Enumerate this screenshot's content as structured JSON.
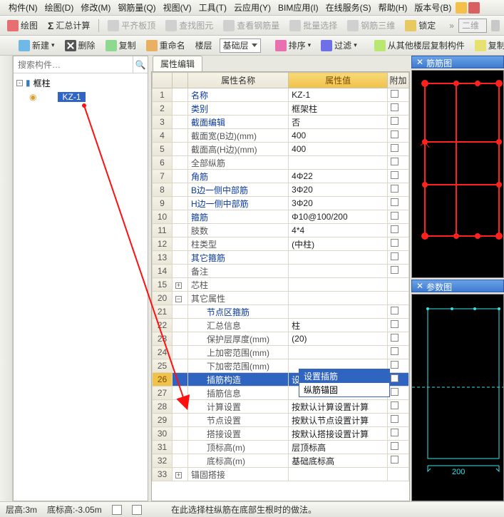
{
  "menu": [
    "构件(N)",
    "绘图(D)",
    "修改(M)",
    "钢筋量(Q)",
    "视图(V)",
    "工具(T)",
    "云应用(Y)",
    "BIM应用(I)",
    "在线服务(S)",
    "帮助(H)",
    "版本号(B)"
  ],
  "toolbar1": {
    "draw": "绘图",
    "sumcalc": "汇总计算",
    "flatslab": "平齐板顶",
    "findelem": "查找图元",
    "viewrebar": "查看钢筋量",
    "batchsel": "批量选择",
    "rebar3d": "钢筋三维",
    "lock": "锁定",
    "view2d": "二维"
  },
  "toolbar2": {
    "new": "新建",
    "del": "删除",
    "copy": "复制",
    "rename": "重命名",
    "floor": "楼层",
    "layer": "基础层",
    "sort": "排序",
    "filter": "过滤",
    "copyfloor": "从其他楼层复制构件",
    "copymember": "复制构件到其"
  },
  "search_placeholder": "搜索构件…",
  "tree": {
    "root": "框柱",
    "leaf": "KZ-1"
  },
  "tab": "属性编辑",
  "headers": {
    "name": "属性名称",
    "value": "属性值",
    "attach": "附加"
  },
  "rows": [
    {
      "n": "1",
      "name": "名称",
      "v": "KZ-1",
      "link": true
    },
    {
      "n": "2",
      "name": "类别",
      "v": "框架柱",
      "link": true
    },
    {
      "n": "3",
      "name": "截面编辑",
      "v": "否",
      "link": true
    },
    {
      "n": "4",
      "name": "截面宽(B边)(mm)",
      "v": "400"
    },
    {
      "n": "5",
      "name": "截面高(H边)(mm)",
      "v": "400"
    },
    {
      "n": "6",
      "name": "全部纵筋",
      "v": "",
      "plain": true
    },
    {
      "n": "7",
      "name": "角筋",
      "v": "4Φ22",
      "link": true
    },
    {
      "n": "8",
      "name": "B边一侧中部筋",
      "v": "3Φ20",
      "link": true
    },
    {
      "n": "9",
      "name": "H边一侧中部筋",
      "v": "3Φ20",
      "link": true
    },
    {
      "n": "10",
      "name": "箍筋",
      "v": "Φ10@100/200",
      "link": true
    },
    {
      "n": "11",
      "name": "肢数",
      "v": "4*4"
    },
    {
      "n": "12",
      "name": "柱类型",
      "v": "(中柱)"
    },
    {
      "n": "13",
      "name": "其它箍筋",
      "v": "",
      "link": true
    },
    {
      "n": "14",
      "name": "备注",
      "v": ""
    }
  ],
  "group1": {
    "n": "15",
    "pm": "+",
    "name": "芯柱"
  },
  "group2": {
    "n": "20",
    "pm": "−",
    "name": "其它属性"
  },
  "rows2": [
    {
      "n": "21",
      "name": "节点区箍筋",
      "v": "",
      "link": true,
      "indent": true
    },
    {
      "n": "22",
      "name": "汇总信息",
      "v": "柱",
      "indent": true
    },
    {
      "n": "23",
      "name": "保护层厚度(mm)",
      "v": "(20)",
      "indent": true
    },
    {
      "n": "24",
      "name": "上加密范围(mm)",
      "v": "",
      "indent": true
    },
    {
      "n": "25",
      "name": "下加密范围(mm)",
      "v": "",
      "indent": true
    }
  ],
  "selrow": {
    "n": "26",
    "name": "插筋构造",
    "v": "设置插筋"
  },
  "dropdown": {
    "opt1": "设置插筋",
    "opt2": "纵筋锚固"
  },
  "rows3": [
    {
      "n": "27",
      "name": "插筋信息",
      "v": "",
      "indent": true
    },
    {
      "n": "28",
      "name": "计算设置",
      "v": "按默认计算设置计算",
      "indent": true
    },
    {
      "n": "29",
      "name": "节点设置",
      "v": "按默认节点设置计算",
      "indent": true
    },
    {
      "n": "30",
      "name": "搭接设置",
      "v": "按默认搭接设置计算",
      "indent": true
    },
    {
      "n": "31",
      "name": "顶标高(m)",
      "v": "层顶标高",
      "indent": true
    },
    {
      "n": "32",
      "name": "底标高(m)",
      "v": "基础底标高",
      "indent": true
    }
  ],
  "group3": {
    "n": "33",
    "pm": "+",
    "name": "锚固搭接"
  },
  "right": {
    "rebar_title": "筋筋图",
    "param_title": "参数图",
    "dim": "200"
  },
  "status": {
    "h": "层高:3m",
    "b": "底标高:-3.05m"
  },
  "hint": "在此选择柱纵筋在底部生根时的做法。"
}
